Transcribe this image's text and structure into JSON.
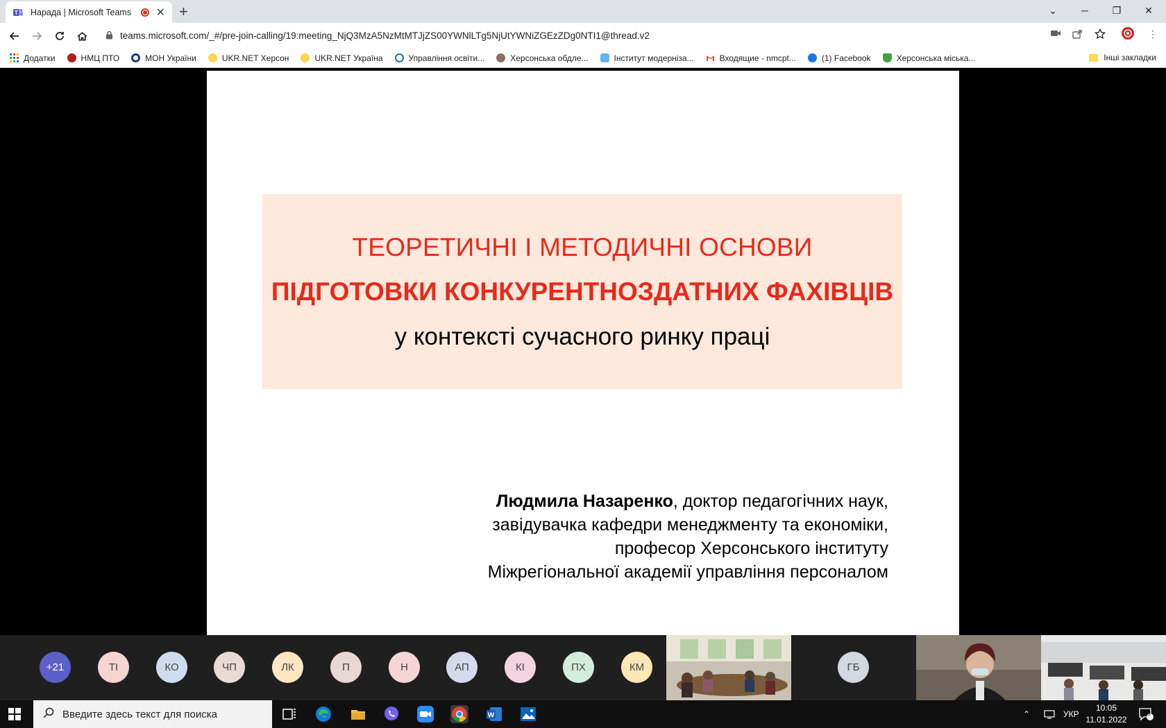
{
  "browser": {
    "tab_title": "Нарада | Microsoft Teams",
    "url": "teams.microsoft.com/_#/pre-join-calling/19:meeting_NjQ3MzA5NzMtMTJjZS00YWNlLTg5NjUtYWNiZGEzZDg0NTI1@thread.v2",
    "bookmarks": [
      "Додатки",
      "НМЦ ПТО",
      "МОН України",
      "UKR.NET Херсон",
      "UKR.NET  Україна",
      "Управління освіти...",
      "Херсонська обдле...",
      "Інститут модерніза...",
      "Входящие - nmcpt...",
      "(1) Facebook",
      "Херсонська міська..."
    ],
    "other_bookmarks": "Інші закладки"
  },
  "slide": {
    "title_line1": "ТЕОРЕТИЧНІ І МЕТОДИЧНІ ОСНОВИ",
    "title_line2": "ПІДГОТОВКИ КОНКУРЕНТНОЗДАТНИХ ФАХІВЦІВ",
    "title_line3": "у контексті сучасного ринку праці",
    "author_name": "Людмила Назаренко",
    "author_line1_rest": ", доктор педагогічних наук,",
    "author_line2": "завідувачка кафедри менеджменту та економіки,",
    "author_line3": "професор Херсонського інституту",
    "author_line4": "Міжрегіональної академії управління персоналом"
  },
  "participants": {
    "more": "+21",
    "avatars": [
      "ТІ",
      "КО",
      "ЧП",
      "ЛК",
      "П",
      "Н",
      "АП",
      "КІ",
      "ПХ",
      "КМ"
    ],
    "last_avatar": "ГБ"
  },
  "taskbar": {
    "search_placeholder": "Введите здесь текст для поиска",
    "language": "УКР",
    "time": "10:05",
    "date": "11.01.2022",
    "notifications": "3"
  },
  "colors": {
    "slide_title_red": "#e8291b",
    "title_box_bg": "#fde9dc",
    "participants_bg": "#1f1f1f"
  }
}
